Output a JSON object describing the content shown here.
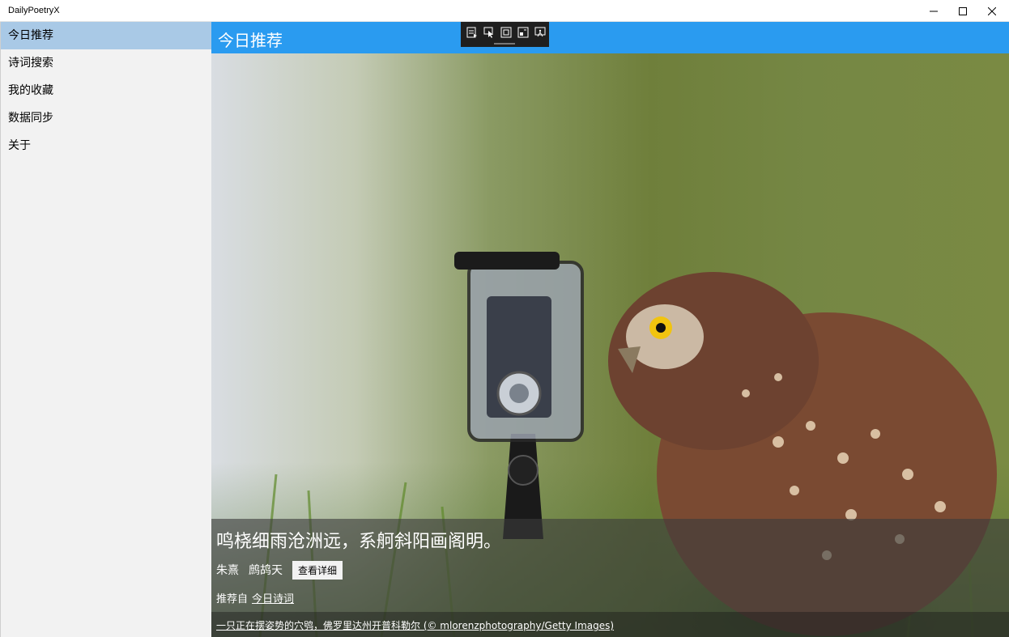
{
  "window": {
    "title": "DailyPoetryX",
    "controls": {
      "minimize": "minimize-icon",
      "maximize": "maximize-icon",
      "close": "close-icon"
    }
  },
  "sidebar": {
    "items": [
      {
        "label": "今日推荐",
        "selected": true
      },
      {
        "label": "诗词搜索",
        "selected": false
      },
      {
        "label": "我的收藏",
        "selected": false
      },
      {
        "label": "数据同步",
        "selected": false
      },
      {
        "label": "关于",
        "selected": false
      }
    ]
  },
  "header": {
    "title": "今日推荐",
    "color": "#2a9bf0"
  },
  "devtools": {
    "tools": [
      "app-toolbar-icon",
      "select-element-icon",
      "display-layout-adorners-icon",
      "track-focus-icon",
      "display-accessibility-icon"
    ]
  },
  "poem": {
    "line": "鸣桡细雨沧洲远，系舸斜阳画阁明。",
    "author": "朱熹",
    "title": "鹧鸪天",
    "detail_button": "查看详细",
    "source_prefix": "推荐自",
    "source_link": "今日诗词"
  },
  "image_credit": "一只正在摆姿势的穴鸮，佛罗里达州开普科勒尔 (© mlorenzphotography/Getty Images)",
  "colors": {
    "accent": "#2a9bf0",
    "selected_nav": "#a9c9e6",
    "sidebar_bg": "#f2f2f2"
  }
}
